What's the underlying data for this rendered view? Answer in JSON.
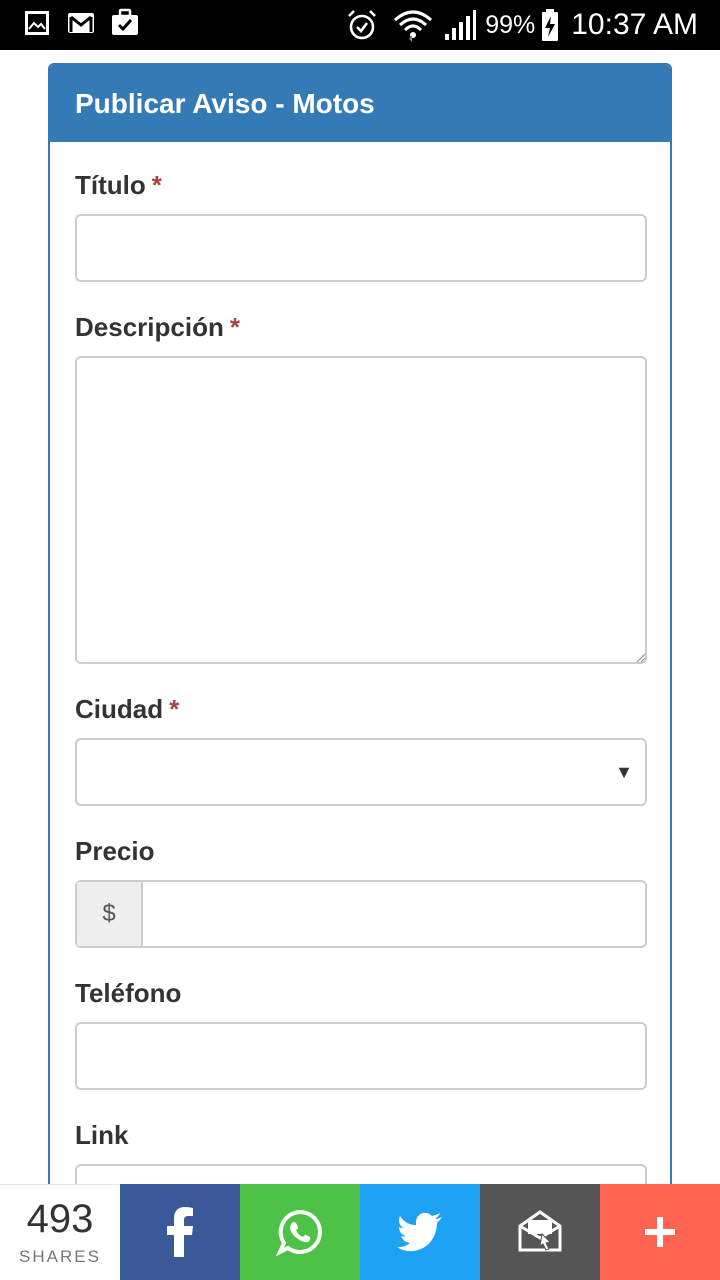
{
  "status_bar": {
    "battery": "99%",
    "time": "10:37 AM",
    "icons": [
      "gallery-icon",
      "gmail-icon",
      "task-icon",
      "alarm-icon",
      "wifi-icon",
      "signal-icon",
      "battery-charging-icon"
    ]
  },
  "panel": {
    "title": "Publicar Aviso - Motos",
    "accent": "#337ab7",
    "required_color": "#a94442"
  },
  "form": {
    "titulo": {
      "label": "Título",
      "required": "*",
      "value": ""
    },
    "descripcion": {
      "label": "Descripción",
      "required": "*",
      "value": ""
    },
    "ciudad": {
      "label": "Ciudad",
      "required": "*",
      "selected": ""
    },
    "precio": {
      "label": "Precio",
      "addon": "$",
      "value": ""
    },
    "telefono": {
      "label": "Teléfono",
      "value": ""
    },
    "link": {
      "label": "Link",
      "value": ""
    }
  },
  "share": {
    "count": "493",
    "label": "SHARES",
    "buttons": [
      {
        "name": "facebook",
        "color": "#3b5998"
      },
      {
        "name": "whatsapp",
        "color": "#4dc247"
      },
      {
        "name": "twitter",
        "color": "#1da1f2"
      },
      {
        "name": "email",
        "color": "#555555"
      },
      {
        "name": "more",
        "color": "#ff6550"
      }
    ]
  }
}
